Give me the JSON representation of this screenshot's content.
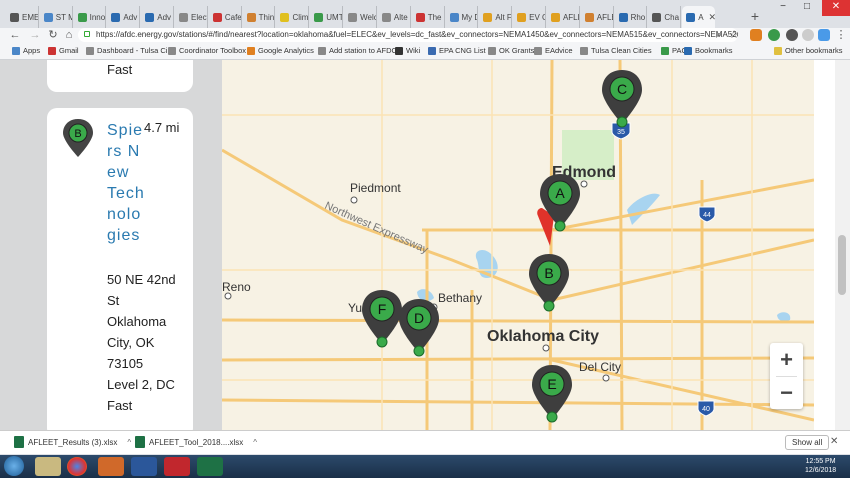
{
  "tabs": [
    {
      "label": "EMES",
      "color": "#555"
    },
    {
      "label": "ST M",
      "color": "#4a86c8"
    },
    {
      "label": "Inno",
      "color": "#3a9a4a"
    },
    {
      "label": "Adv",
      "color": "#2a6ab0"
    },
    {
      "label": "Adv",
      "color": "#2a6ab0"
    },
    {
      "label": "Elect",
      "color": "#888"
    },
    {
      "label": "Cafe",
      "color": "#c33"
    },
    {
      "label": "Thin",
      "color": "#d08030"
    },
    {
      "label": "Clim",
      "color": "#e0c020"
    },
    {
      "label": "UMT",
      "color": "#3a9a4a"
    },
    {
      "label": "Welc",
      "color": "#888"
    },
    {
      "label": "Alte",
      "color": "#888"
    },
    {
      "label": "The",
      "color": "#c33"
    },
    {
      "label": "My D",
      "color": "#4a86c8"
    },
    {
      "label": "Alt F",
      "color": "#e0a020"
    },
    {
      "label": "EV C",
      "color": "#e0a020"
    },
    {
      "label": "AFLE",
      "color": "#e0a020"
    },
    {
      "label": "AFLE",
      "color": "#d08030"
    },
    {
      "label": "Rho",
      "color": "#2a6ab0"
    },
    {
      "label": "Cha",
      "color": "#555"
    },
    {
      "label": "A",
      "color": "#2a6ab0"
    }
  ],
  "address": {
    "url": "https://afdc.energy.gov/stations/#/find/nearest?location=oklahoma&fuel=ELEC&ev_levels=dc_fast&ev_connectors=NEMA1450&ev_connectors=NEMA515&ev_connectors=NEMA520..."
  },
  "bookmarks": [
    {
      "label": "Apps",
      "color": "#4a86c8"
    },
    {
      "label": "Gmail",
      "color": "#c33"
    },
    {
      "label": "Dashboard - Tulsa Ci",
      "color": "#888"
    },
    {
      "label": "Coordinator Toolbox",
      "color": "#888"
    },
    {
      "label": "Google Analytics",
      "color": "#e08020"
    },
    {
      "label": "Add station to AFDC",
      "color": "#888"
    },
    {
      "label": "Wiki",
      "color": "#333"
    },
    {
      "label": "EPA CNG List",
      "color": "#3a6ab0"
    },
    {
      "label": "OK Grants",
      "color": "#888"
    },
    {
      "label": "EAdvice",
      "color": "#888"
    },
    {
      "label": "Tulsa Clean Cities",
      "color": "#888"
    },
    {
      "label": "PAC",
      "color": "#3a9a4a"
    },
    {
      "label": "Bookmarks",
      "color": "#2a6ab0"
    },
    {
      "label": "Other bookmarks",
      "color": "#e0c040"
    }
  ],
  "prev_card": {
    "text": "Fast"
  },
  "station": {
    "marker": "B",
    "name": "Spiers New Technologies",
    "distance": "4.7 mi",
    "address_lines": [
      "50 NE 42nd",
      "St",
      "Oklahoma",
      "City, OK",
      "73105",
      "Level 2, DC",
      "Fast"
    ]
  },
  "map": {
    "places": [
      "Piedmont",
      "Edmond",
      "Northwest Expressway",
      "Reno",
      "Yukon",
      "Bethany",
      "Oklahoma City",
      "Del City"
    ],
    "highway_shields": [
      "35",
      "44",
      "40"
    ],
    "markers": [
      "A",
      "B",
      "C",
      "D",
      "E",
      "F"
    ],
    "zoom_in": "+",
    "zoom_out": "−"
  },
  "downloads": [
    {
      "label": "AFLEET_Results (3).xlsx"
    },
    {
      "label": "AFLEET_Tool_2018....xlsx"
    }
  ],
  "show_all": "Show all",
  "clock": {
    "time": "12:55 PM",
    "date": "12/6/2018"
  }
}
